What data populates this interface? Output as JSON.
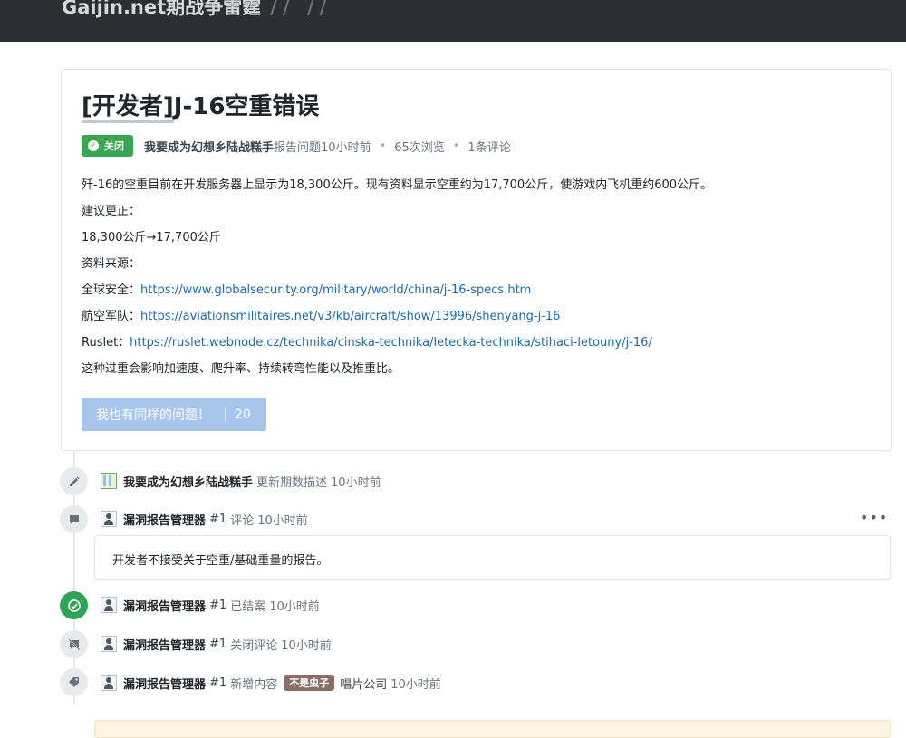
{
  "header": {
    "brand": "Gaijin.net期战争雷霆",
    "slashes": "//  //"
  },
  "issue": {
    "title_prefix": "[开发者]",
    "title_main": "J-16空重错误",
    "status": "关闭",
    "author": "我要成为幻想乡陆战糕手",
    "reported": "报告问题10小时前",
    "views": "65次浏览",
    "comments": "1条评论",
    "lines": {
      "l1": "歼-16的空重目前在开发服务器上显示为18,300公斤。现有资料显示空重约为17,700公斤，使游戏内飞机重约600公斤。",
      "l2": "建议更正：",
      "l3": "18,300公斤→17,700公斤",
      "l4": "资料来源：",
      "s1_label": "全球安全：",
      "s1_url": "https://www.globalsecurity.org/military/world/china/j-16-specs.htm",
      "s2_label": "航空军队：",
      "s2_url": "https://aviationsmilitaires.net/v3/kb/aircraft/show/13996/shenyang-j-16",
      "s3_label": "Ruslet：",
      "s3_url": "https://ruslet.webnode.cz/technika/cinska-technika/letecka-technika/stihaci-letouny/j-16/",
      "l8": "这种过重会影响加速度、爬升率、持续转弯性能以及推重比。"
    },
    "same_issue": {
      "label": "我也有同样的问题！",
      "count": "20"
    }
  },
  "timeline": {
    "e1": {
      "who": "我要成为幻想乡陆战糕手",
      "action": "更新期数描述",
      "time": "10小时前"
    },
    "e2": {
      "who": "漏洞报告管理器",
      "num": "#1",
      "action": "评论",
      "time": "10小时前"
    },
    "comment_text": "开发者不接受关于空重/基础重量的报告。",
    "more": "•••",
    "e3": {
      "who": "漏洞报告管理器",
      "num": "#1",
      "action": "已结案",
      "time": "10小时前"
    },
    "e4": {
      "who": "漏洞报告管理器",
      "num": "#1",
      "action": "关闭评论",
      "time": "10小时前"
    },
    "e5": {
      "who": "漏洞报告管理器",
      "num": "#1",
      "action": "新增内容",
      "tag": "不是虫子",
      "tag_text": "唱片公司",
      "time": "10小时前"
    }
  },
  "colors": {
    "closed_badge": "#3aa552",
    "link": "#1a6aa8",
    "same_button": "#a8c5ec",
    "tag_not_bug": "#8c6e64"
  }
}
